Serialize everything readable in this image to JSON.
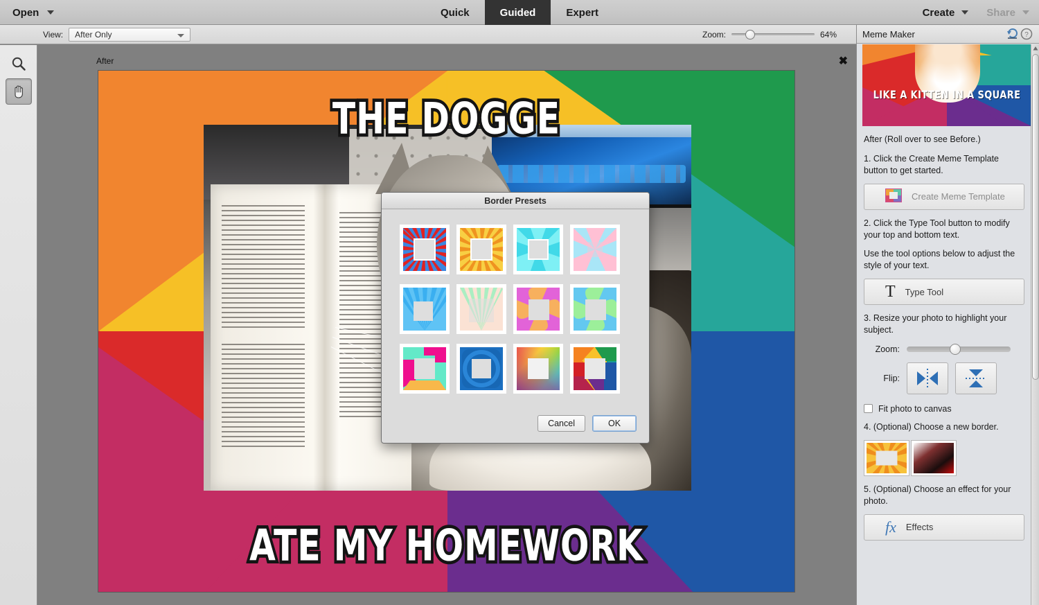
{
  "app": {
    "open_label": "Open",
    "modes": [
      {
        "label": "Quick",
        "active": false
      },
      {
        "label": "Guided",
        "active": true
      },
      {
        "label": "Expert",
        "active": false
      }
    ],
    "create_label": "Create",
    "share_label": "Share"
  },
  "optionbar": {
    "view_label": "View:",
    "view_value": "After Only",
    "zoom_label": "Zoom:",
    "zoom_value": "64%",
    "zoom_percent": 64
  },
  "tools": [
    {
      "name": "zoom-tool",
      "active": false
    },
    {
      "name": "hand-tool",
      "active": true
    }
  ],
  "canvas": {
    "after_label": "After",
    "close_label": "✖",
    "meme_top_text": "THE DOGGE",
    "meme_bottom_text": "ATE MY HOMEWORK",
    "border_colors": {
      "top_left_orange": "#F1852F",
      "top_yellow": "#F6C026",
      "top_right_green": "#1F9A4D",
      "right_teal": "#26A69A",
      "right_blue": "#1F57A6",
      "bottom_purple": "#6B2D8E",
      "bottom_magenta": "#C32D63",
      "left_red": "#DA2A2A"
    }
  },
  "dialog": {
    "title": "Border Presets",
    "cancel_label": "Cancel",
    "ok_label": "OK",
    "presets": [
      {
        "name": "red-blue-sunburst"
      },
      {
        "name": "yellow-orange-sunburst"
      },
      {
        "name": "cyan-pinwheel"
      },
      {
        "name": "pink-blue-rays"
      },
      {
        "name": "blue-sunburst"
      },
      {
        "name": "pastel-mint-peach-rays"
      },
      {
        "name": "pink-orange-swirl"
      },
      {
        "name": "green-blue-swirl"
      },
      {
        "name": "magenta-mint-blocks"
      },
      {
        "name": "blue-rounded-rings"
      },
      {
        "name": "rainbow-watercolor"
      },
      {
        "name": "color-block-frame"
      }
    ]
  },
  "panel": {
    "title": "Meme Maker",
    "reset_icon": "reset-icon",
    "help_icon": "help-icon",
    "preview_caption": "LIKE A KITTEN IN A SQUARE",
    "after_note": "After (Roll over to see Before.)",
    "step1_text": "1. Click the Create Meme Template button to get started.",
    "create_meme_template_label": "Create Meme Template",
    "step2_text": "2. Click the Type Tool button to modify your top and bottom text.",
    "step2_sub_text": "Use the tool options below to adjust the style of your text.",
    "type_tool_label": "Type Tool",
    "type_tool_glyph": "T",
    "step3_text": "3. Resize your photo to highlight your subject.",
    "zoom_label": "Zoom:",
    "zoom_percent": 52,
    "flip_label": "Flip:",
    "flip_horizontal_icon": "flip-horizontal-icon",
    "flip_vertical_icon": "flip-vertical-icon",
    "fit_photo_label": "Fit photo to canvas",
    "fit_photo_checked": false,
    "step4_text": "4. (Optional) Choose a new border.",
    "border_swatches": [
      {
        "name": "yellow-sunburst-border"
      },
      {
        "name": "red-black-gradient-border"
      }
    ],
    "step5_text": "5. (Optional) Choose an effect for your photo.",
    "effects_label": "Effects",
    "effects_glyph": "fx"
  }
}
